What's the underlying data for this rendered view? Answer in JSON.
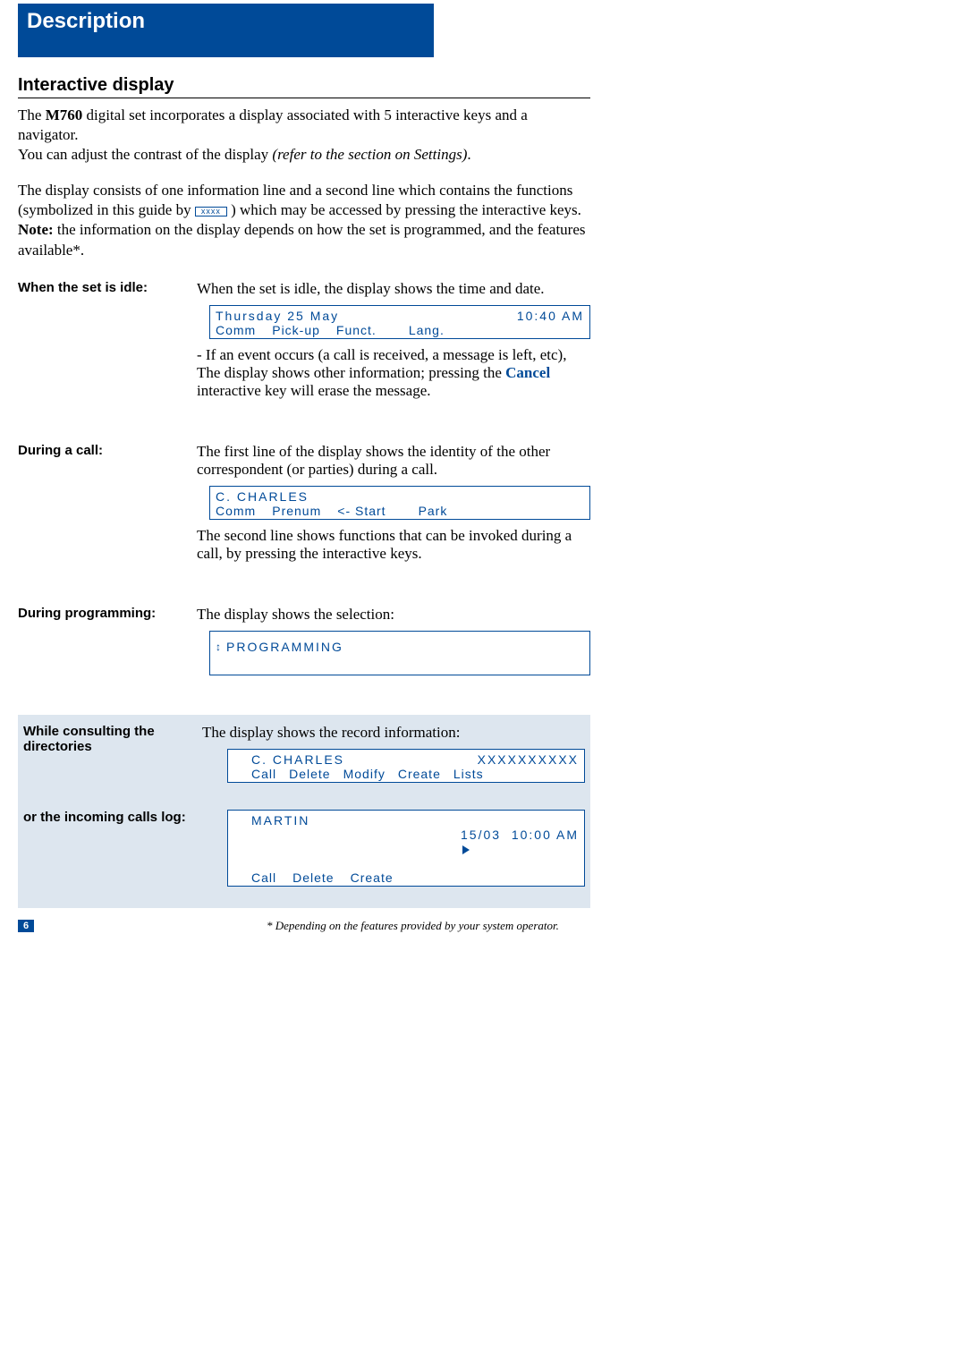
{
  "tab": {
    "title": "Description"
  },
  "section": {
    "title": "Interactive display"
  },
  "intro": {
    "p1a": "The ",
    "model": "M760",
    "p1b": " digital set incorporates a display associated with 5 interactive keys and a navigator.",
    "p2a": "You can adjust the contrast of the display ",
    "p2_italic": "(refer to the section on Settings)",
    "p2b": ".",
    "p3a": "The display consists of one information line and a second line which contains the functions (symbolized in this guide by ",
    "p3_box": "xxxx",
    "p3b": " ) which may be accessed by pressing the interactive keys.",
    "p4_label": "Note:",
    "p4": " the information on the display depends on how the set is programmed, and the features available*."
  },
  "idle": {
    "label": "When the set is idle:",
    "desc": "When the set is idle, the display shows the time and date.",
    "date": "Thursday 25 May",
    "time": "10:40 AM",
    "fn": [
      "Comm",
      "Pick-up",
      "Funct.",
      "Lang."
    ],
    "after_a": "- If an event occurs (a call is received, a message is left, etc),",
    "after_b1": "The display shows other information; pressing the ",
    "after_cancel": "Cancel",
    "after_b2": " interactive key will erase the message."
  },
  "call": {
    "label": "During a call:",
    "desc": "The first line of the display shows the identity of the other correspondent (or parties) during a call.",
    "name": "C. CHARLES",
    "fn": [
      "Comm",
      "Prenum",
      "<- Start",
      "Park"
    ],
    "after": "The second line shows functions that can be invoked during a call, by pressing the interactive keys."
  },
  "prog": {
    "label": "During programming:",
    "desc": "The display shows the selection:",
    "text": "PROGRAMMING"
  },
  "dir": {
    "label": "While consulting the directories",
    "desc": "The display shows the record information:",
    "name": "C. CHARLES",
    "num": "XXXXXXXXXX",
    "fn": [
      "Call",
      "Delete",
      "Modify",
      "Create",
      "Lists"
    ]
  },
  "log": {
    "label": "or the incoming calls log:",
    "name": "MARTIN",
    "date": "15/03",
    "time": "10:00 AM",
    "fn": [
      "Call",
      "Delete",
      "Create"
    ]
  },
  "footer": {
    "pagenum": "6",
    "note": "* Depending on the features provided by your system operator."
  }
}
